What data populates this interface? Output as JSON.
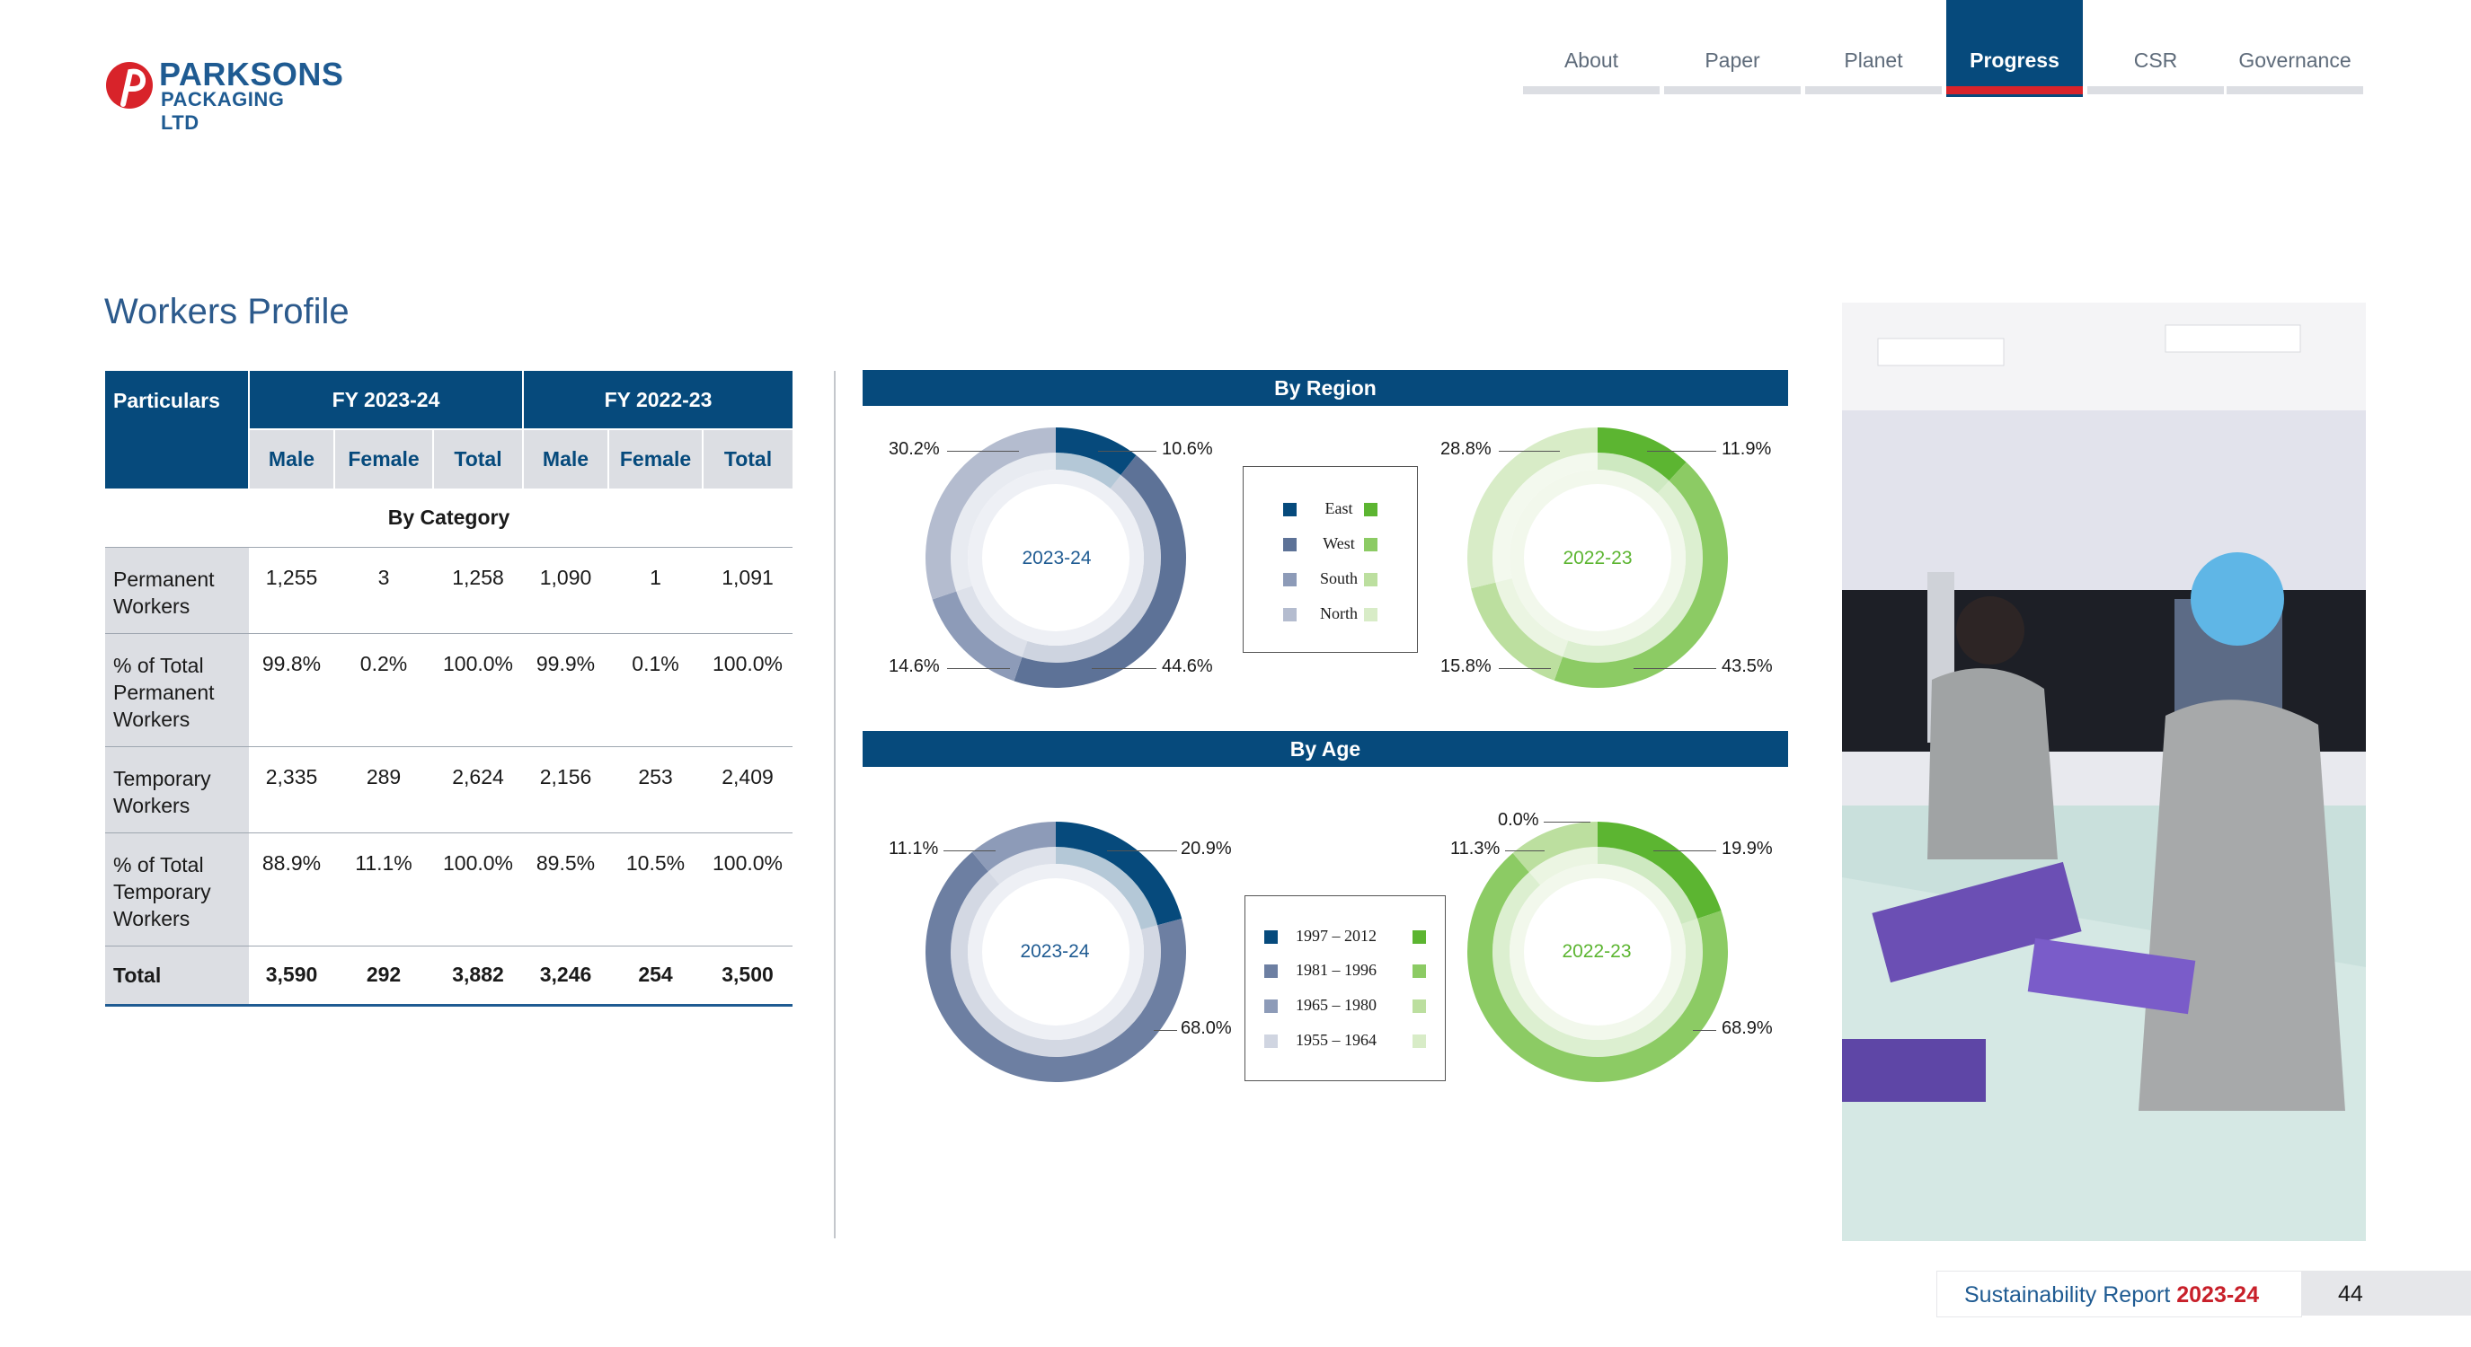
{
  "logo": {
    "name": "PARKSONS",
    "sub": "PACKAGING LTD"
  },
  "nav": [
    "About",
    "Paper",
    "Planet",
    "Progress",
    "CSR",
    "Governance"
  ],
  "nav_active": "Progress",
  "title": "Workers Profile",
  "table": {
    "particulars": "Particulars",
    "fy1": "FY 2023-24",
    "fy2": "FY 2022-23",
    "subheads": [
      "Male",
      "Female",
      "Total",
      "Male",
      "Female",
      "Total"
    ],
    "section": "By Category",
    "rows": [
      {
        "label": "Permanent Workers",
        "values": [
          "1,255",
          "3",
          "1,258",
          "1,090",
          "1",
          "1,091"
        ]
      },
      {
        "label": "% of Total Permanent Workers",
        "values": [
          "99.8%",
          "0.2%",
          "100.0%",
          "99.9%",
          "0.1%",
          "100.0%"
        ]
      },
      {
        "label": "Temporary Workers",
        "values": [
          "2,335",
          "289",
          "2,624",
          "2,156",
          "253",
          "2,409"
        ]
      },
      {
        "label": "% of Total Temporary Workers",
        "values": [
          "88.9%",
          "11.1%",
          "100.0%",
          "89.5%",
          "10.5%",
          "100.0%"
        ]
      },
      {
        "label": "Total",
        "values": [
          "3,590",
          "292",
          "3,882",
          "3,246",
          "254",
          "3,500"
        ]
      }
    ]
  },
  "region": {
    "title": "By Region",
    "year1": "2023-24",
    "year2": "2022-23",
    "legend": [
      "East",
      "West",
      "South",
      "North"
    ],
    "labels1": {
      "tl": "30.2%",
      "tr": "10.6%",
      "bl": "14.6%",
      "br": "44.6%"
    },
    "labels2": {
      "tl": "28.8%",
      "tr": "11.9%",
      "bl": "15.8%",
      "br": "43.5%"
    },
    "values1": [
      10.6,
      44.6,
      14.6,
      30.2
    ],
    "values2": [
      11.9,
      43.5,
      15.8,
      28.8
    ]
  },
  "age": {
    "title": "By Age",
    "year1": "2023-24",
    "year2": "2022-23",
    "legend": [
      "1997 – 2012",
      "1981 – 1996",
      "1965 – 1980",
      "1955 – 1964"
    ],
    "labels1": {
      "tl": "11.1%",
      "tr": "20.9%",
      "br": "68.0%"
    },
    "labels2": {
      "top": "0.0%",
      "tl": "11.3%",
      "tr": "19.9%",
      "br": "68.9%"
    },
    "values1": [
      20.9,
      68.0,
      11.1,
      0.0
    ],
    "values2": [
      19.9,
      68.9,
      11.3,
      0.0
    ]
  },
  "colors": {
    "blue": [
      "#064a7c",
      "#5d7297",
      "#8d9bb8",
      "#b4bccf"
    ],
    "blue_age": [
      "#064a7c",
      "#6d7fa2",
      "#8d9bb8",
      "#d0d5e1"
    ],
    "green": [
      "#5cb531",
      "#8ccb64",
      "#bcdf9f",
      "#d8ecc7"
    ]
  },
  "footer": {
    "text": "Sustainability Report ",
    "year": "2023-24",
    "page": "44"
  }
}
